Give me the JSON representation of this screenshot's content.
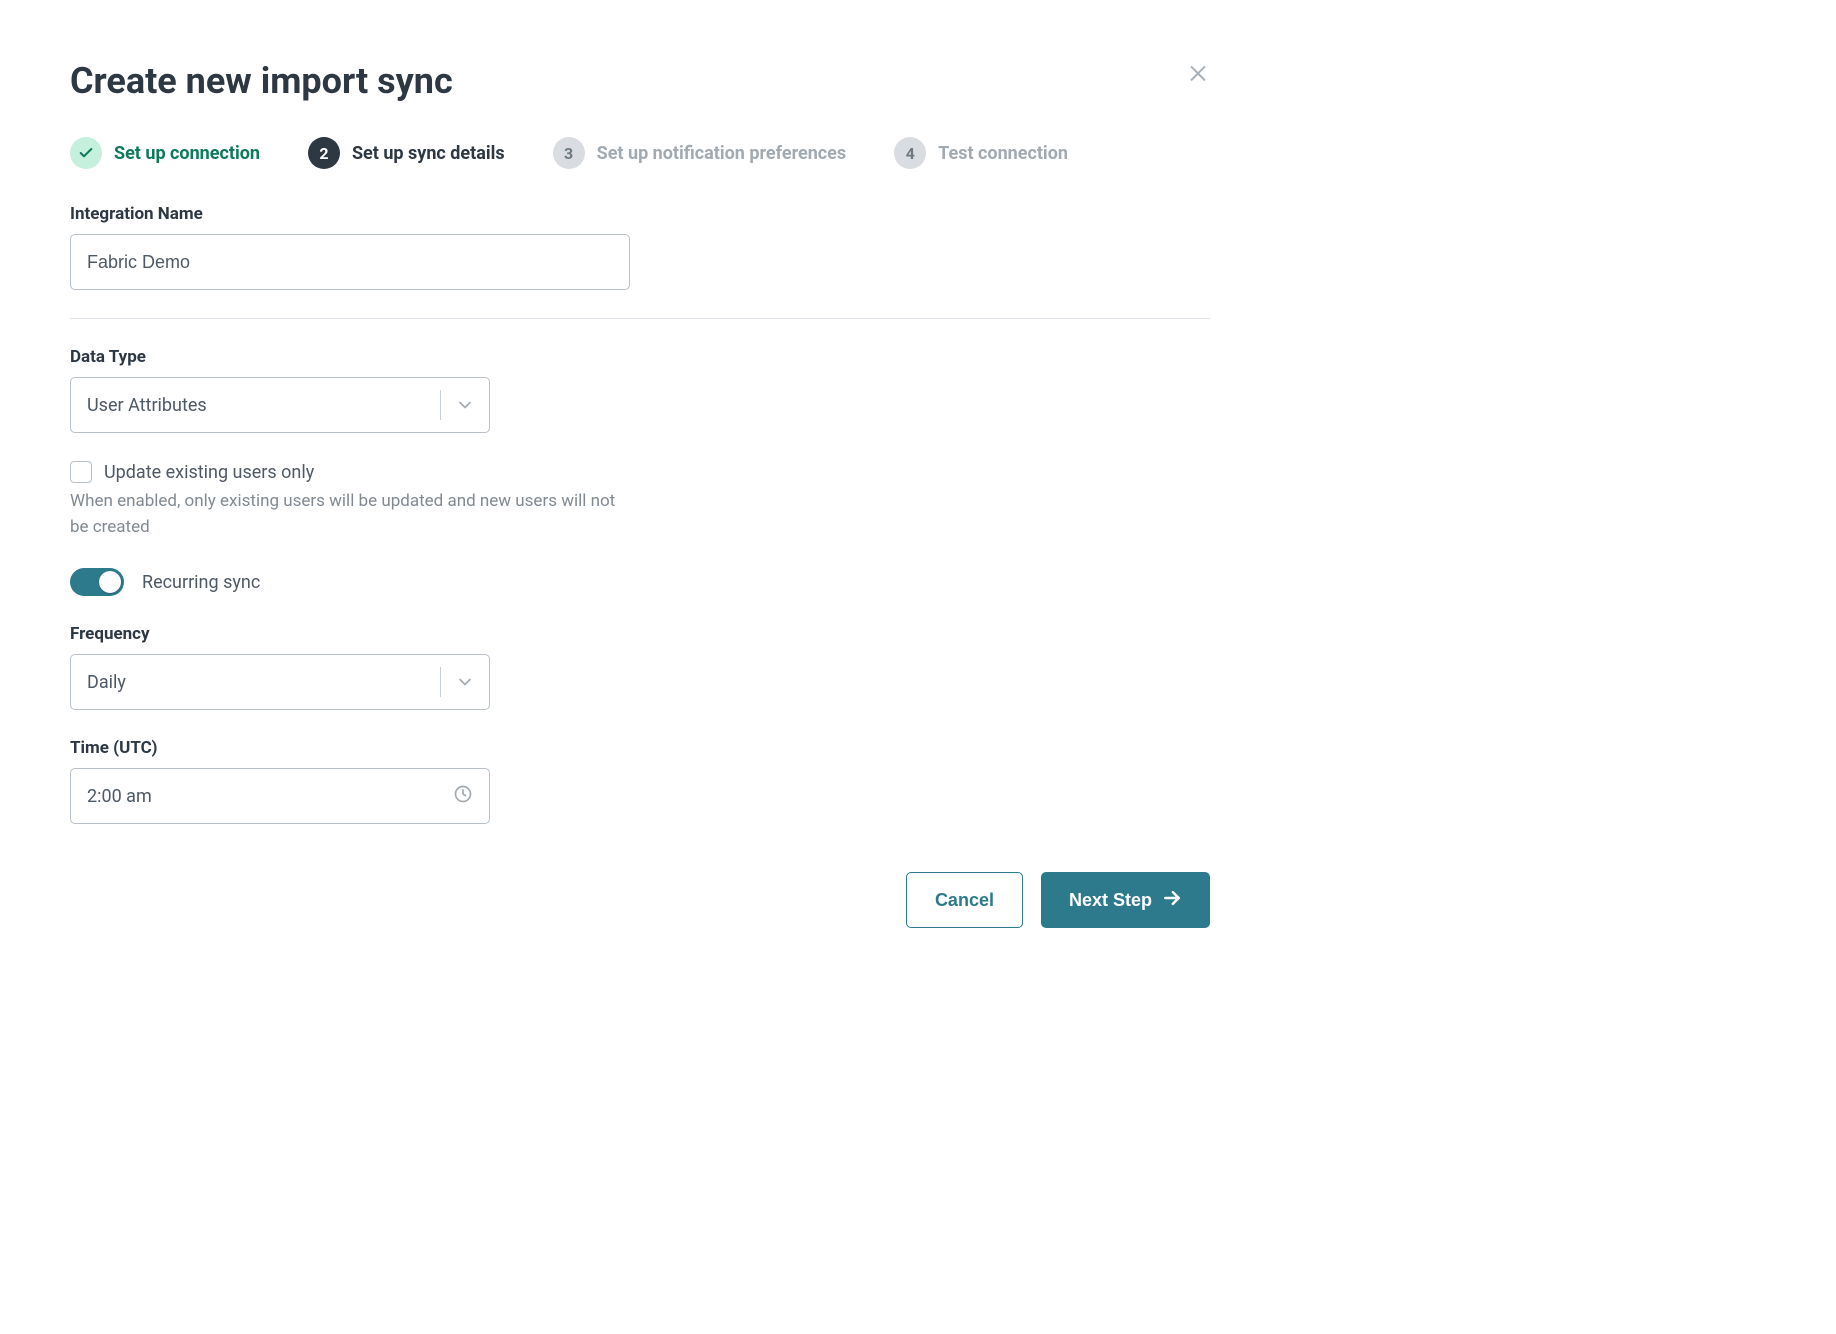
{
  "header": {
    "title": "Create new import sync"
  },
  "stepper": {
    "steps": [
      {
        "label": "Set up connection",
        "state": "completed"
      },
      {
        "index": "2",
        "label": "Set up sync details",
        "state": "current"
      },
      {
        "index": "3",
        "label": "Set up notification preferences",
        "state": "pending"
      },
      {
        "index": "4",
        "label": "Test connection",
        "state": "pending"
      }
    ]
  },
  "form": {
    "integration_name": {
      "label": "Integration Name",
      "value": "Fabric Demo"
    },
    "data_type": {
      "label": "Data Type",
      "value": "User Attributes"
    },
    "update_existing": {
      "label": "Update existing users only",
      "checked": false,
      "helper": "When enabled, only existing users will be updated and new users will not be created"
    },
    "recurring": {
      "label": "Recurring sync",
      "on": true
    },
    "frequency": {
      "label": "Frequency",
      "value": "Daily"
    },
    "time": {
      "label": "Time (UTC)",
      "value": "2:00 am"
    }
  },
  "footer": {
    "cancel": "Cancel",
    "next": "Next Step"
  }
}
